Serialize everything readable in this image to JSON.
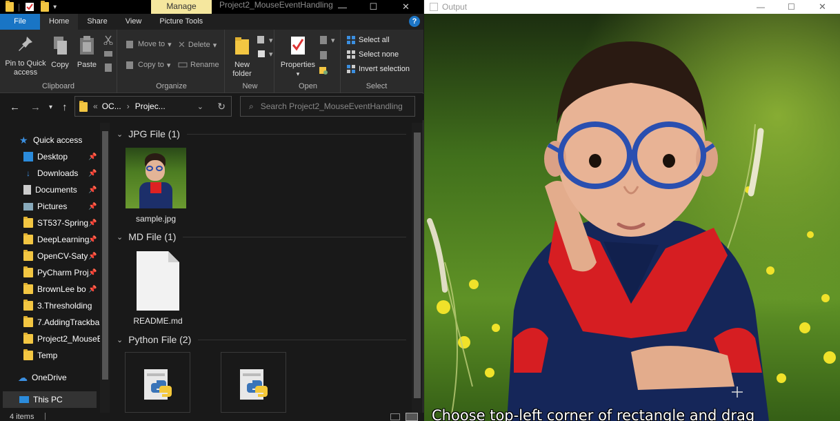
{
  "titlebar": {
    "manage_tab": "Manage",
    "title": "Project2_MouseEventHandling",
    "min": "—",
    "max": "☐",
    "close": "✕"
  },
  "ribbon_tabs": [
    "File",
    "Home",
    "Share",
    "View",
    "Picture Tools"
  ],
  "help": "?",
  "ribbon": {
    "clipboard": {
      "pin": "Pin to Quick",
      "pin2": "access",
      "copy": "Copy",
      "paste": "Paste",
      "label": "Clipboard"
    },
    "organize": {
      "move_to": "Move to",
      "copy_to": "Copy to",
      "delete": "Delete",
      "rename": "Rename",
      "label": "Organize"
    },
    "new": {
      "new_folder": "New",
      "new_folder2": "folder",
      "label": "New"
    },
    "open": {
      "properties": "Properties",
      "label": "Open"
    },
    "select": {
      "select_all": "Select all",
      "select_none": "Select none",
      "invert": "Invert selection",
      "label": "Select"
    }
  },
  "address": {
    "crumb1": "OC...",
    "crumb2": "Projec...",
    "sep": "«",
    "search_placeholder": "Search Project2_MouseEventHandling"
  },
  "nav": {
    "quick_access": "Quick access",
    "items": [
      "Desktop",
      "Downloads",
      "Documents",
      "Pictures",
      "ST537-Spring",
      "DeepLearning",
      "OpenCV-Saty",
      "PyCharm Proj",
      "BrownLee bo",
      "3.Thresholding",
      "7.AddingTrackba",
      "Project2_MouseE",
      "Temp"
    ],
    "onedrive": "OneDrive",
    "this_pc": "This PC"
  },
  "content": {
    "group1": "JPG File (1)",
    "file1": "sample.jpg",
    "group2": "MD File (1)",
    "file2": "README.md",
    "group3": "Python File (2)"
  },
  "status": {
    "items": "4 items"
  },
  "output": {
    "title": "Output",
    "caption": "Choose top-left corner of rectangle and drag"
  },
  "colors": {
    "accent": "#1975c5",
    "manage": "#f5e79e",
    "folder": "#f3c642"
  }
}
